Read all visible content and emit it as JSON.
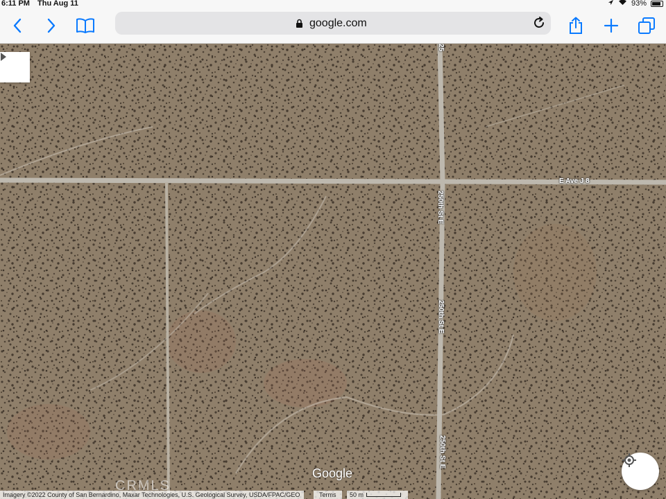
{
  "status_bar": {
    "time": "6:11 PM",
    "date": "Thu Aug 11",
    "battery": "93%"
  },
  "browser": {
    "url": "google.com",
    "icons": [
      "chevron-left-icon",
      "chevron-right-icon",
      "bookmarks-icon",
      "lock-icon",
      "reload-icon",
      "share-icon",
      "plus-icon",
      "tabs-icon"
    ]
  },
  "map": {
    "roads": {
      "horizontal": "E Ave J 8",
      "vertical_1": "250th St E",
      "vertical_2": "250th St E",
      "vertical_3": "250th St E",
      "vertical_top": "25"
    },
    "logo": "Google",
    "watermark": "CRMLS",
    "attribution": "Imagery ©2022 County of San Bernardino, Maxar Technologies, U.S. Geological Survey, USDA/FPAC/GEO",
    "terms": "Terms",
    "scale": "50 m"
  },
  "colors": {
    "terrain": "#8d7d68",
    "road": "#bdb8ae",
    "toolbar": "#f7f7f7",
    "accent": "#0a7aff"
  }
}
